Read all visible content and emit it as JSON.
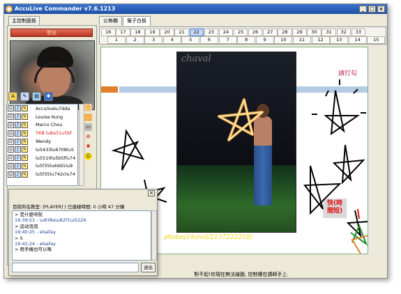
{
  "window": {
    "title": "AccuLive Commander v7.6.1213",
    "controls": [
      "_",
      "□",
      "×"
    ]
  },
  "left_panel": {
    "tab_label": "主控制面板",
    "exit_label": "登出",
    "tool_icons": [
      "font-icon",
      "pen-icon",
      "doc-icon",
      "net-icon"
    ],
    "users": [
      {
        "name": "Acculivelu7dda"
      },
      {
        "name": "Louise Kung"
      },
      {
        "name": "Marco Chou"
      },
      {
        "name": "TKB lu8a31u5bf",
        "alert": true
      },
      {
        "name": "Wendy"
      },
      {
        "name": "lu5433lu6708lu5"
      },
      {
        "name": "lu5510lu5b5flu74"
      },
      {
        "name": "lu5f35lu6dd1lu9"
      },
      {
        "name": "lu5f35lu742clu74"
      }
    ]
  },
  "tabs": [
    {
      "label": "公佈欄",
      "active": false
    },
    {
      "label": "電子白板",
      "active": true
    }
  ],
  "pages_row1": [
    "16",
    "17",
    "18",
    "19",
    "20",
    "21",
    "22",
    "23",
    "24",
    "25",
    "26",
    "27",
    "28",
    "29",
    "30",
    "31",
    "32",
    "33"
  ],
  "pages_row2": [
    "1",
    "2",
    "3",
    "4",
    "5",
    "6",
    "7",
    "8",
    "9",
    "10",
    "11",
    "12",
    "13",
    "14",
    "15"
  ],
  "selected_page": "22",
  "board": {
    "photo_watermark": "chaval",
    "photo_credit": "photos/chaval/2137222210/",
    "handwriting": "請打勾",
    "red_note_line1": "快(時",
    "red_note_line2": "間短)"
  },
  "status_text": "對不起!你現在無法繪圖, 控制權在講師手上.",
  "chat": {
    "close_label": "×",
    "header": "目前所在教室: [PLAYER] | 已連線時間: 0 小時 47 分鐘",
    "lines": [
      {
        "text": "> 是什麼呀就",
        "meta": false
      },
      {
        "text": "19:39:51 -  \\u838a\\u82f1\\u5229",
        "meta": true
      },
      {
        "text": "> 运动泡泡",
        "meta": false
      },
      {
        "text": "19:40:25 -  elsafay",
        "meta": true
      },
      {
        "text": "> S",
        "meta": false
      },
      {
        "text": "19:41:24 -  elsafay",
        "meta": true
      },
      {
        "text": "> 用手機也可以嗎",
        "meta": false
      }
    ],
    "input_value": "",
    "send_label": "送出"
  },
  "colors": {
    "title_bar": "#1c4fa8",
    "exit_button": "#b9321f",
    "alert_user": "#dd1111"
  }
}
